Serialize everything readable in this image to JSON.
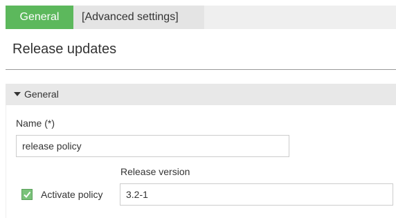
{
  "tabs": {
    "general_label": "General",
    "advanced_label": "[Advanced settings]",
    "active": "General"
  },
  "page": {
    "title": "Release updates"
  },
  "section": {
    "title": "General",
    "expanded": true
  },
  "form": {
    "name_label": "Name (*)",
    "name_value": "release policy",
    "activate_label": "Activate policy",
    "activate_checked": true,
    "version_label": "Release version",
    "version_value": "3.2-1"
  },
  "colors": {
    "active_tab": "#5cb85c",
    "checkbox": "#7ac27a"
  }
}
